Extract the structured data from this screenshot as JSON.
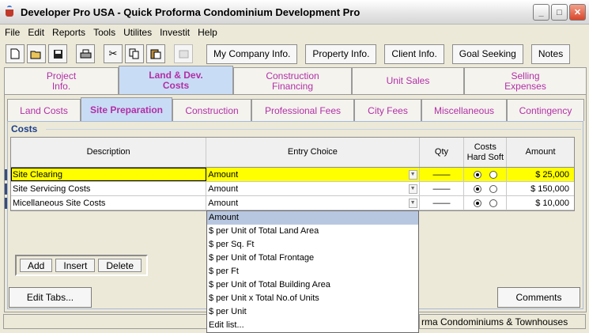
{
  "window": {
    "title": "Developer Pro  USA - Quick Proforma Condominium Development Pro",
    "minimize": "_",
    "maximize": "□",
    "close": "✕"
  },
  "menu": [
    {
      "label": "File"
    },
    {
      "label": "Edit"
    },
    {
      "label": "Reports"
    },
    {
      "label": "Tools"
    },
    {
      "label": "Utilites"
    },
    {
      "label": "Investit"
    },
    {
      "label": "Help"
    }
  ],
  "toolbar": {
    "icons": [
      "new-file-icon",
      "open-folder-icon",
      "save-icon",
      "print-icon",
      "cut-icon",
      "copy-icon",
      "paste-icon",
      "calculator-icon"
    ],
    "my_company": "My Company Info.",
    "property": "Property Info.",
    "client": "Client Info.",
    "goal_seeking": "Goal Seeking",
    "notes": "Notes"
  },
  "main_tabs": [
    {
      "line1": "Project",
      "line2": "Info."
    },
    {
      "line1": "Land & Dev.",
      "line2": "Costs"
    },
    {
      "line1": "Construction",
      "line2": "Financing"
    },
    {
      "line1": "Unit Sales",
      "line2": ""
    },
    {
      "line1": "Selling",
      "line2": "Expenses"
    }
  ],
  "sub_tabs": [
    "Land Costs",
    "Site Preparation",
    "Construction",
    "Professional Fees",
    "City Fees",
    "Miscellaneous",
    "Contingency"
  ],
  "costs": {
    "label": "Costs",
    "headers": {
      "description": "Description",
      "entry": "Entry Choice",
      "qty": "Qty",
      "costs_line1": "Costs",
      "costs_line2": "Hard Soft",
      "amount": "Amount"
    },
    "rows": [
      {
        "description": "Site Clearing",
        "entry": "Amount",
        "qty": "——",
        "hard": true,
        "amount": "$ 25,000"
      },
      {
        "description": "Site Servicing Costs",
        "entry": "Amount",
        "qty": "——",
        "hard": true,
        "amount": "$ 150,000"
      },
      {
        "description": "Micellaneous Site Costs",
        "entry": "Amount",
        "qty": "——",
        "hard": true,
        "amount": "$ 10,000"
      }
    ]
  },
  "dropdown_options": [
    "Amount",
    "$ per Unit of Total Land Area",
    "$ per Sq. Ft",
    "$ per Unit of Total Frontage",
    "$ per Ft",
    "$ per Unit of Total Building Area",
    "$ per Unit x Total No.of Units",
    "$ per Unit",
    "Edit list..."
  ],
  "row_buttons": {
    "add": "Add",
    "insert": "Insert",
    "delete": "Delete"
  },
  "edit_tabs": "Edit Tabs...",
  "comments": "Comments",
  "status": {
    "right": "rma Condominiums & Townhouses"
  }
}
